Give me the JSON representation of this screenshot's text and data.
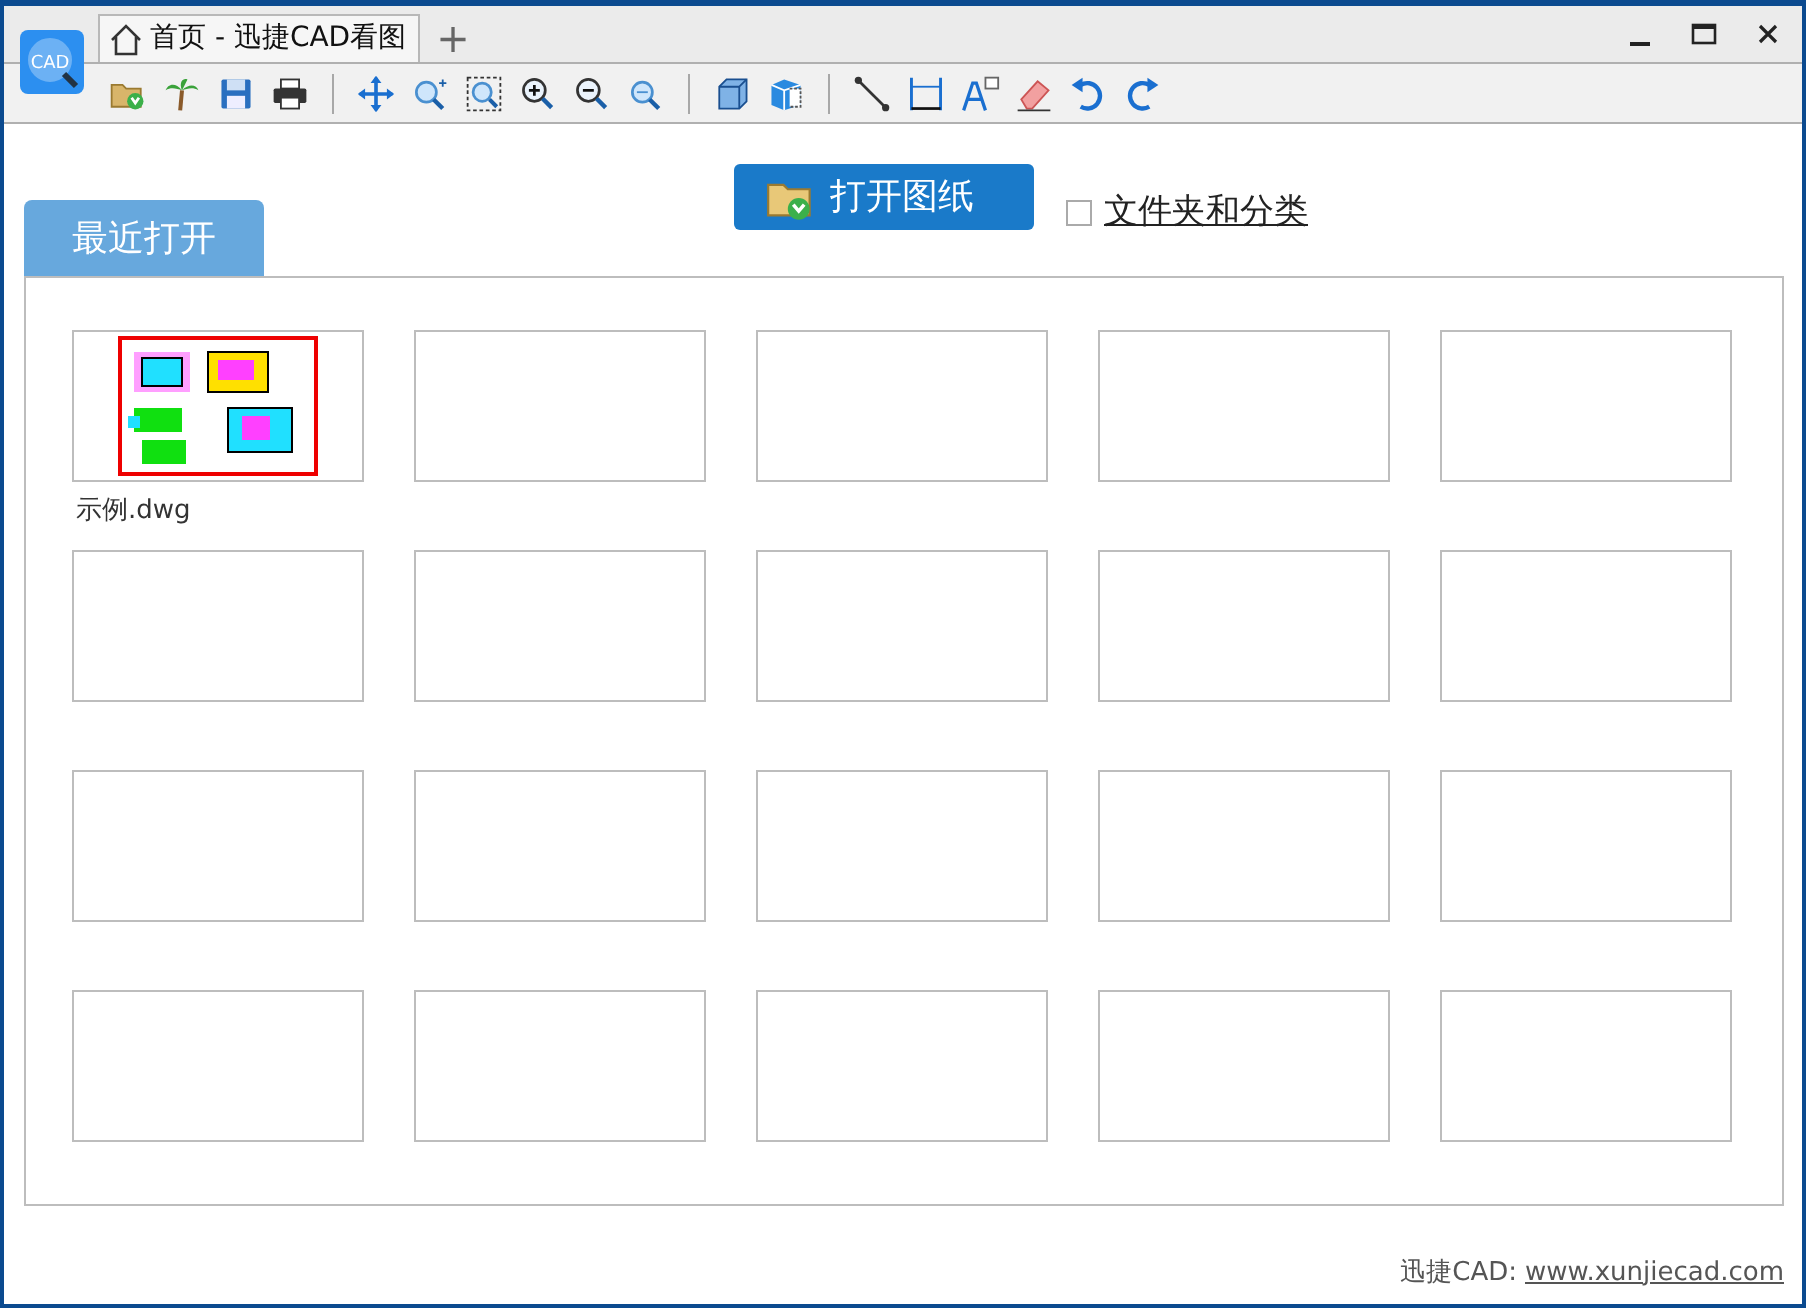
{
  "window": {
    "tab_title": "首页 - 迅捷CAD看图",
    "new_tab": "+",
    "logo_text": "CAD"
  },
  "toolbar": [
    {
      "kind": "open"
    },
    {
      "kind": "palm"
    },
    {
      "kind": "save"
    },
    {
      "kind": "print"
    },
    {
      "kind": "sep"
    },
    {
      "kind": "pan"
    },
    {
      "kind": "zoomfit"
    },
    {
      "kind": "zoomwin"
    },
    {
      "kind": "zoomin"
    },
    {
      "kind": "zoomout"
    },
    {
      "kind": "zoomprev"
    },
    {
      "kind": "sep"
    },
    {
      "kind": "box"
    },
    {
      "kind": "box3d"
    },
    {
      "kind": "sep"
    },
    {
      "kind": "line"
    },
    {
      "kind": "dim"
    },
    {
      "kind": "text"
    },
    {
      "kind": "erase"
    },
    {
      "kind": "undo"
    },
    {
      "kind": "redo"
    }
  ],
  "open_button": "打开图纸",
  "folder_option": {
    "label": "文件夹和分类",
    "checked": false
  },
  "tabs": [
    {
      "label": "最近打开",
      "selected": true
    }
  ],
  "files": [
    {
      "kind": "drawing",
      "name": "示例.dwg"
    },
    {
      "kind": "empty"
    },
    {
      "kind": "empty"
    },
    {
      "kind": "empty"
    },
    {
      "kind": "empty"
    },
    {
      "kind": "empty"
    },
    {
      "kind": "empty"
    },
    {
      "kind": "empty"
    },
    {
      "kind": "empty"
    },
    {
      "kind": "empty"
    },
    {
      "kind": "empty"
    },
    {
      "kind": "empty"
    },
    {
      "kind": "empty"
    },
    {
      "kind": "empty"
    },
    {
      "kind": "empty"
    },
    {
      "kind": "empty"
    },
    {
      "kind": "empty"
    },
    {
      "kind": "empty"
    },
    {
      "kind": "empty"
    },
    {
      "kind": "empty"
    }
  ],
  "footer": {
    "label": "迅捷CAD:",
    "link": "www.xunjiecad.com"
  }
}
